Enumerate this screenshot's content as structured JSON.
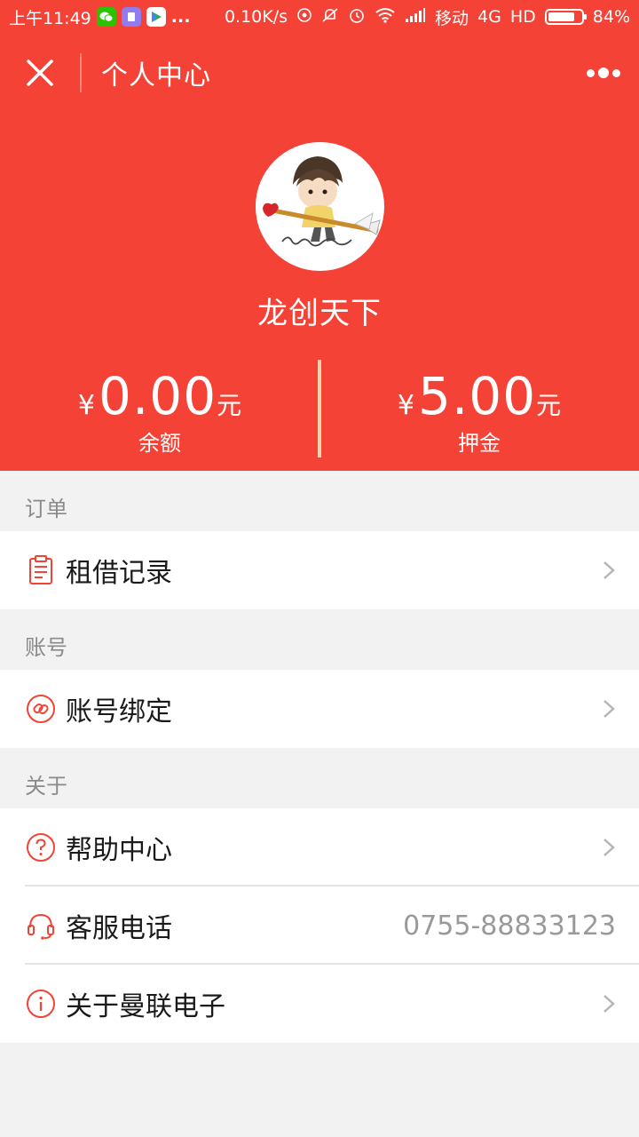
{
  "status_bar": {
    "time": "上午11:49",
    "ellipsis": "...",
    "speed": "0.10K/s",
    "carrier": "移动",
    "network": "4G",
    "hd": "HD",
    "battery": "84%",
    "battery_level": 0.84
  },
  "nav": {
    "title": "个人中心"
  },
  "profile": {
    "username": "龙创天下"
  },
  "stats": [
    {
      "currency": "¥",
      "amount": "0.00",
      "unit": "元",
      "label": "余额"
    },
    {
      "currency": "¥",
      "amount": "5.00",
      "unit": "元",
      "label": "押金"
    }
  ],
  "sections": [
    {
      "header": "订单",
      "rows": [
        {
          "label": "租借记录",
          "icon": "clipboard-icon"
        }
      ]
    },
    {
      "header": "账号",
      "rows": [
        {
          "label": "账号绑定",
          "icon": "link-icon"
        }
      ]
    },
    {
      "header": "关于",
      "rows": [
        {
          "label": "帮助中心",
          "icon": "question-icon"
        },
        {
          "label": "客服电话",
          "icon": "headset-icon",
          "value": "0755-88833123"
        },
        {
          "label": "关于曼联电子",
          "icon": "info-icon"
        }
      ]
    }
  ],
  "colors": {
    "accent": "#f44336",
    "divider": "#e8d5b0",
    "background": "#f2f2f2"
  }
}
